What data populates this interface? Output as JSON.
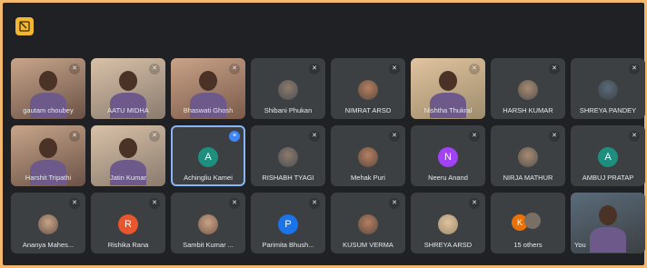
{
  "window": {
    "icon": "sticky-note-icon",
    "accent": "#f2b631"
  },
  "participants": [
    {
      "name": "gautam choubey",
      "avatar": "photo"
    },
    {
      "name": "AATU MIDHA",
      "avatar": "photo"
    },
    {
      "name": "Bhaswati Ghosh",
      "avatar": "photo"
    },
    {
      "name": "Shibani Phukan",
      "avatar": "photo"
    },
    {
      "name": "NIMRAT ARSD",
      "avatar": "photo"
    },
    {
      "name": "Nishtha Thukral",
      "avatar": "photo"
    },
    {
      "name": "HARSH KUMAR",
      "avatar": "photo"
    },
    {
      "name": "SHREYA PANDEY",
      "avatar": "photo"
    },
    {
      "name": "Harshit Tripathi",
      "avatar": "photo"
    },
    {
      "name": "Jatin Kumar",
      "avatar": "photo"
    },
    {
      "name": "Achingliu Kamei",
      "avatar": "A",
      "color": "#1e8e7e",
      "speaking": true
    },
    {
      "name": "RISHABH TYAGI",
      "avatar": "photo"
    },
    {
      "name": "Mehak Puri",
      "avatar": "photo"
    },
    {
      "name": "Neeru Anand",
      "avatar": "N",
      "color": "#a142f4"
    },
    {
      "name": "NIRJA MATHUR",
      "avatar": "photo"
    },
    {
      "name": "AMBUJ PRATAP",
      "avatar": "A",
      "color": "#1e8e7e"
    },
    {
      "name": "Ananya Mahes...",
      "avatar": "photo"
    },
    {
      "name": "Rishika Rana",
      "avatar": "R",
      "color": "#e8562e"
    },
    {
      "name": "Sambit Kumar ...",
      "avatar": "photo"
    },
    {
      "name": "Parimita Bhush...",
      "avatar": "P",
      "color": "#1a73e8"
    },
    {
      "name": "KUSUM VERMA",
      "avatar": "photo"
    },
    {
      "name": "SHREYA ARSD",
      "avatar": "photo"
    },
    {
      "name": "15 others",
      "avatar": "group"
    },
    {
      "name": "You",
      "avatar": "photo"
    }
  ],
  "others_avatar": "K",
  "mic_icon": "mic-off-icon",
  "speaking_icon": "audio-wave-icon"
}
